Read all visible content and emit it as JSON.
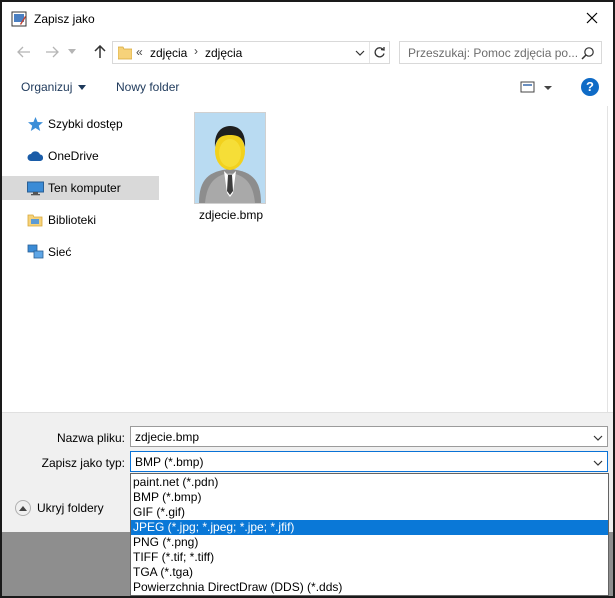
{
  "window": {
    "title": "Zapisz jako"
  },
  "address": {
    "overflow": "«",
    "crumbs": [
      "zdjęcia",
      "zdjęcia"
    ]
  },
  "search": {
    "placeholder": "Przeszukaj: Pomoc zdjęcia po..."
  },
  "toolbar": {
    "organize_label": "Organizuj",
    "new_folder_label": "Nowy folder",
    "help_label": "?"
  },
  "sidebar": {
    "items": [
      {
        "label": "Szybki dostęp",
        "icon": "star-icon"
      },
      {
        "label": "OneDrive",
        "icon": "cloud-icon"
      },
      {
        "label": "Ten komputer",
        "icon": "computer-icon",
        "selected": true
      },
      {
        "label": "Biblioteki",
        "icon": "library-icon"
      },
      {
        "label": "Sieć",
        "icon": "network-icon"
      }
    ]
  },
  "files": [
    {
      "name": "zdjecie.bmp",
      "icon": "user-image-thumbnail"
    }
  ],
  "form": {
    "filename_label": "Nazwa pliku:",
    "filename_value": "zdjecie.bmp",
    "type_label": "Zapisz jako typ:",
    "type_value": "BMP (*.bmp)",
    "hide_folders_label": "Ukryj foldery"
  },
  "type_options": [
    {
      "label": "paint.net (*.pdn)"
    },
    {
      "label": "BMP (*.bmp)"
    },
    {
      "label": "GIF (*.gif)"
    },
    {
      "label": "JPEG (*.jpg; *.jpeg; *.jpe; *.jfif)",
      "highlighted": true
    },
    {
      "label": "PNG (*.png)"
    },
    {
      "label": "TIFF (*.tif; *.tiff)"
    },
    {
      "label": "TGA (*.tga)"
    },
    {
      "label": "Powierzchnia DirectDraw (DDS) (*.dds)"
    }
  ],
  "colors": {
    "accent": "#0a78d7",
    "help": "#0f6bc6",
    "selected_bg": "#d9d9d9"
  }
}
